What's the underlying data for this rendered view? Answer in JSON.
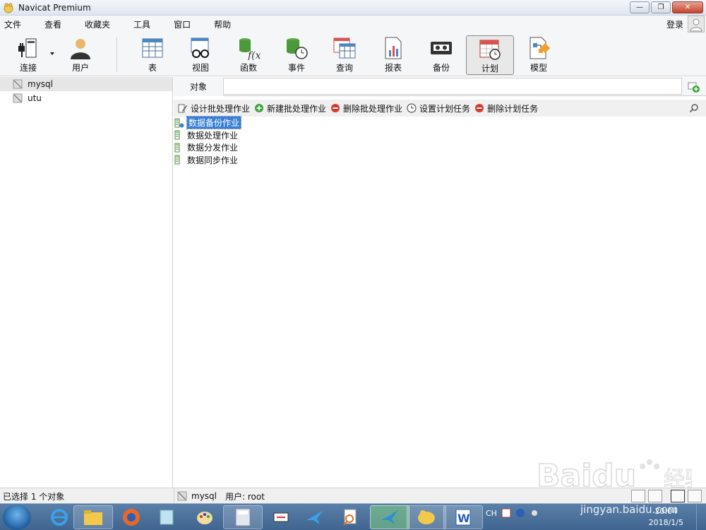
{
  "window": {
    "title": "Navicat Premium"
  },
  "window_buttons": {
    "minimize": "—",
    "restore": "❐",
    "close": "✕"
  },
  "menu": [
    "文件",
    "查看",
    "收藏夹",
    "工具",
    "窗口",
    "帮助"
  ],
  "account": {
    "login_label": "登录"
  },
  "toolbar": [
    {
      "label": "连接",
      "icon": "plug-icon"
    },
    {
      "label": "用户",
      "icon": "user-icon"
    },
    {
      "label": "表",
      "icon": "table-icon"
    },
    {
      "label": "视图",
      "icon": "view-glasses-icon"
    },
    {
      "label": "函数",
      "icon": "function-icon"
    },
    {
      "label": "事件",
      "icon": "event-clock-icon"
    },
    {
      "label": "查询",
      "icon": "query-icon"
    },
    {
      "label": "报表",
      "icon": "report-icon"
    },
    {
      "label": "备份",
      "icon": "backup-tape-icon"
    },
    {
      "label": "计划",
      "icon": "calendar-icon",
      "active": true
    },
    {
      "label": "模型",
      "icon": "model-icon"
    }
  ],
  "connections": [
    {
      "name": "mysql",
      "selected": true
    },
    {
      "name": "utu",
      "selected": false
    }
  ],
  "tabs": {
    "object_tab": "对象"
  },
  "actions": [
    {
      "label": "设计批处理作业",
      "icon": "design-pencil-icon"
    },
    {
      "label": "新建批处理作业",
      "icon": "add-green-icon"
    },
    {
      "label": "删除批处理作业",
      "icon": "remove-red-icon"
    },
    {
      "label": "设置计划任务",
      "icon": "clock-icon"
    },
    {
      "label": "删除计划任务",
      "icon": "remove-red-icon"
    }
  ],
  "objects": [
    {
      "name": "数据备份作业",
      "selected": true
    },
    {
      "name": "数据处理作业",
      "selected": false
    },
    {
      "name": "数据分发作业",
      "selected": false
    },
    {
      "name": "数据同步作业",
      "selected": false
    }
  ],
  "status": {
    "selection": "已选择 1 个对象",
    "connection": "mysql",
    "user": "用户: root"
  },
  "taskbar": {
    "tray_lang": "CH",
    "time": "20:04",
    "date": "2018/1/5"
  },
  "watermark": {
    "url": "jingyan.baidu.com"
  },
  "colors": {
    "selection": "#3a80d5",
    "active_tool_bg": "#e8e8e8",
    "taskbar": "#3f6590"
  }
}
